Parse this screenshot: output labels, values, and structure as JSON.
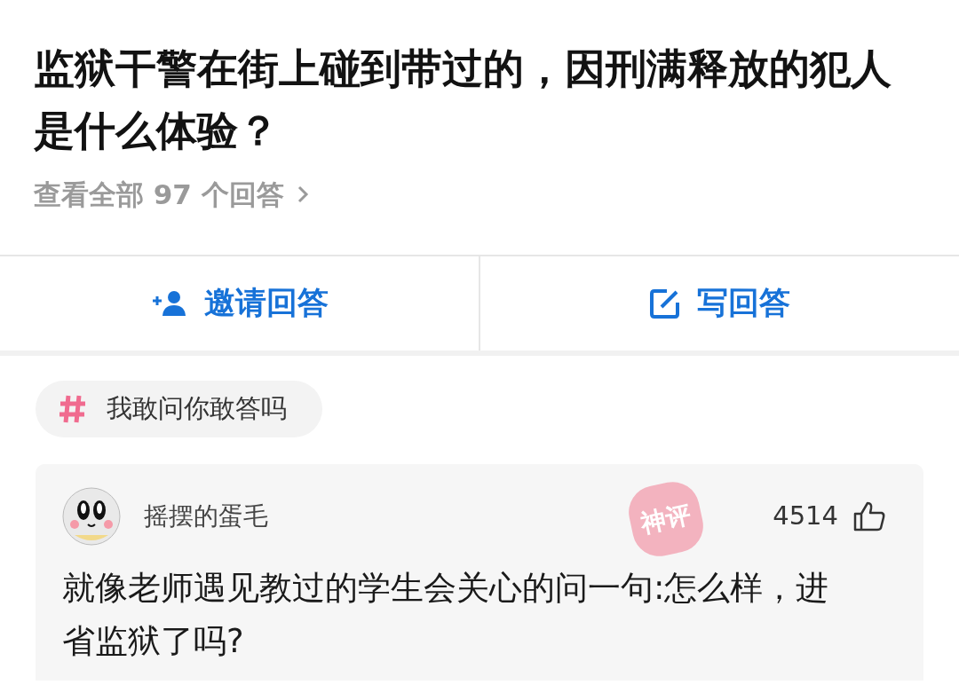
{
  "question": {
    "title": "监狱干警在街上碰到带过的，因刑满释放的犯人是什么体验？",
    "answers_link": "查看全部 97 个回答"
  },
  "actions": [
    {
      "kind": "invite",
      "label": "邀请回答"
    },
    {
      "kind": "write",
      "label": "写回答"
    }
  ],
  "topic_tag": {
    "label": "我敢问你敢答吗"
  },
  "answer": {
    "author": "摇摆的蛋毛",
    "likes": "4514",
    "stamp": "神评",
    "text": "就像老师遇见教过的学生会关心的问一句:怎么样，进省监狱了吗?"
  }
}
